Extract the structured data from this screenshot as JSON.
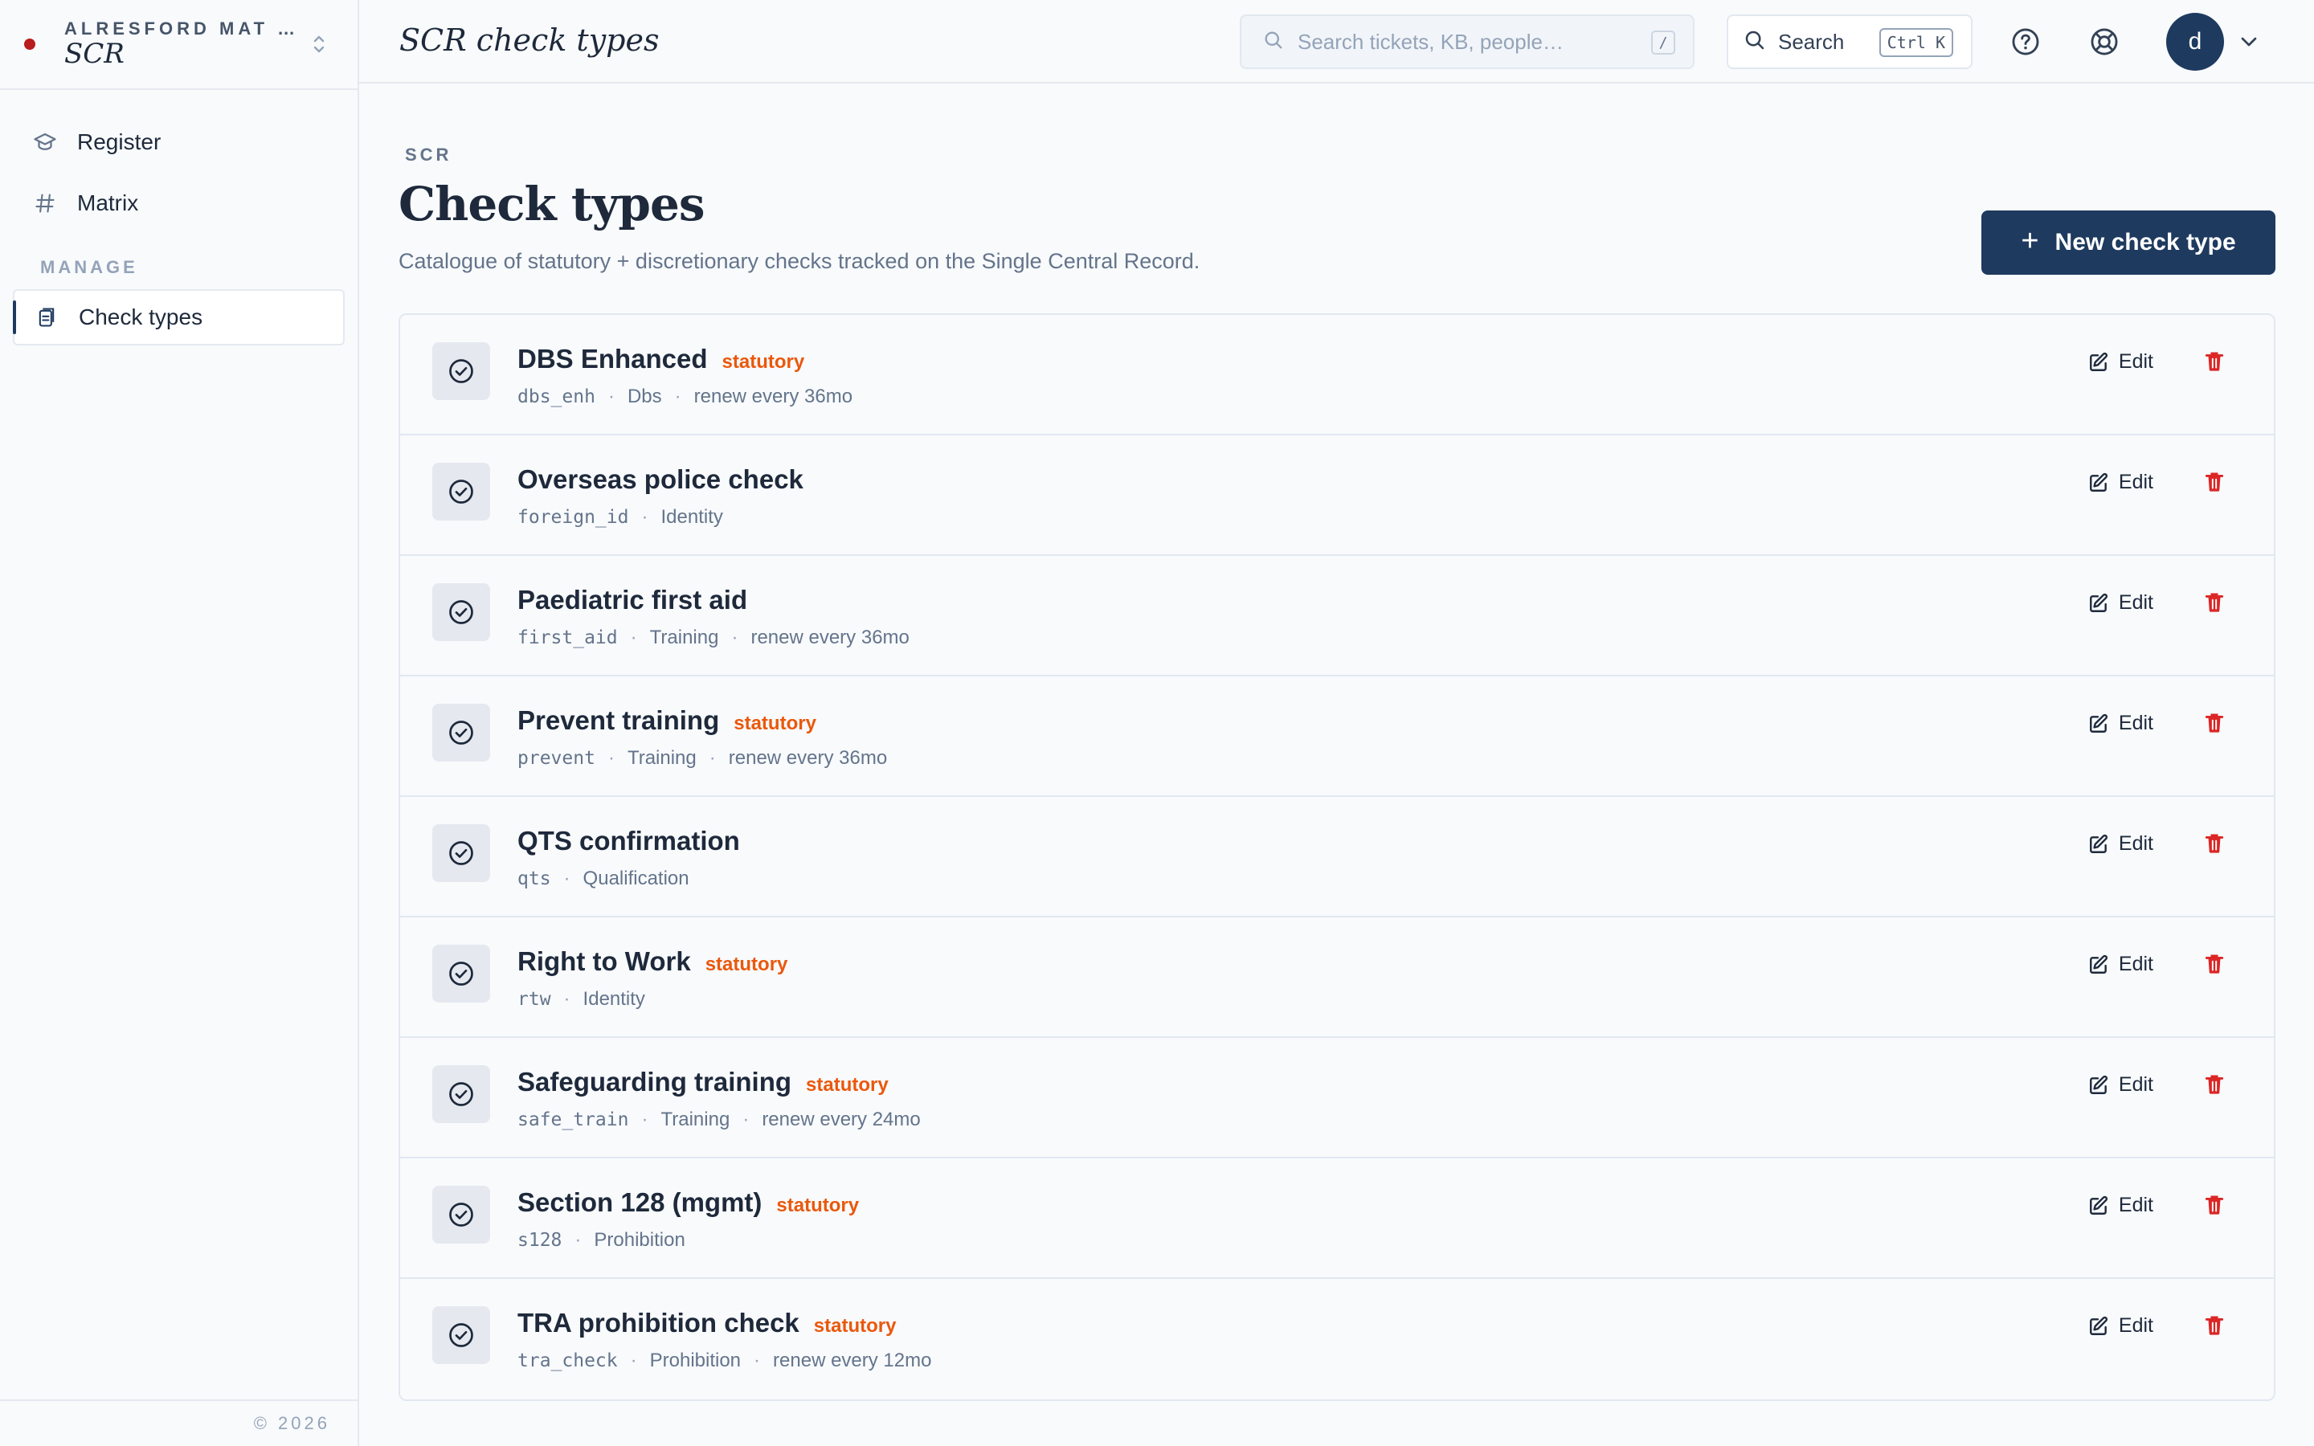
{
  "sidebar": {
    "org": "ALRESFORD MAT …",
    "app": "SCR",
    "items": [
      {
        "label": "Register",
        "icon": "graduation-cap-icon"
      },
      {
        "label": "Matrix",
        "icon": "hash-icon"
      }
    ],
    "section_label": "MANAGE",
    "manage_items": [
      {
        "label": "Check types",
        "icon": "clipboard-icon",
        "active": true
      }
    ],
    "footer": "© 2026"
  },
  "topbar": {
    "title": "SCR check types",
    "search_placeholder": "Search tickets, KB, people…",
    "search_shortcut": "/",
    "search_button_label": "Search",
    "search_button_shortcut": "Ctrl K",
    "avatar_initial": "d"
  },
  "page": {
    "eyebrow": "SCR",
    "title": "Check types",
    "subtitle": "Catalogue of statutory + discretionary checks tracked on the Single Central Record.",
    "new_button": "New check type",
    "edit_label": "Edit"
  },
  "check_types": [
    {
      "name": "DBS Enhanced",
      "badge": "statutory",
      "code": "dbs_enh",
      "category": "Dbs",
      "renew": "renew every 36mo"
    },
    {
      "name": "Overseas police check",
      "badge": "",
      "code": "foreign_id",
      "category": "Identity",
      "renew": ""
    },
    {
      "name": "Paediatric first aid",
      "badge": "",
      "code": "first_aid",
      "category": "Training",
      "renew": "renew every 36mo"
    },
    {
      "name": "Prevent training",
      "badge": "statutory",
      "code": "prevent",
      "category": "Training",
      "renew": "renew every 36mo"
    },
    {
      "name": "QTS confirmation",
      "badge": "",
      "code": "qts",
      "category": "Qualification",
      "renew": ""
    },
    {
      "name": "Right to Work",
      "badge": "statutory",
      "code": "rtw",
      "category": "Identity",
      "renew": ""
    },
    {
      "name": "Safeguarding training",
      "badge": "statutory",
      "code": "safe_train",
      "category": "Training",
      "renew": "renew every 24mo"
    },
    {
      "name": "Section 128 (mgmt)",
      "badge": "statutory",
      "code": "s128",
      "category": "Prohibition",
      "renew": ""
    },
    {
      "name": "TRA prohibition check",
      "badge": "statutory",
      "code": "tra_check",
      "category": "Prohibition",
      "renew": "renew every 12mo"
    }
  ],
  "colors": {
    "primary": "#1e3a5f",
    "statutory": "#ea580c",
    "danger": "#dc2626",
    "brand_dot": "#b91c1c"
  }
}
